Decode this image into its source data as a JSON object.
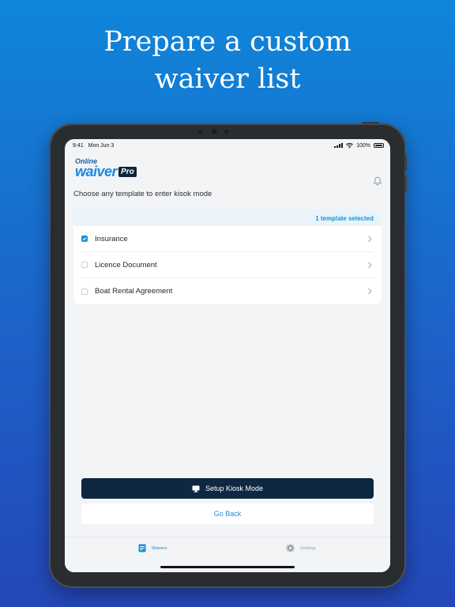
{
  "headline": {
    "line1": "Prepare a custom",
    "line2": "waiver list"
  },
  "statusbar": {
    "time": "9:41",
    "date": "Mon Jun 3",
    "battery": "100%"
  },
  "app": {
    "logo_online": "Online",
    "logo_waiver": "waiver",
    "logo_pro": "Pro"
  },
  "instruction": "Choose any template to enter kisok mode",
  "selection": {
    "count_label": "1 template selected"
  },
  "templates": [
    {
      "label": "Insurance",
      "checked": true
    },
    {
      "label": "Licence Document",
      "checked": false
    },
    {
      "label": "Boat Rental Agreement",
      "checked": false
    }
  ],
  "actions": {
    "setup_kiosk": "Setup Kiosk Mode",
    "go_back": "Go Back"
  },
  "tabs": {
    "waivers": "Waivers",
    "settings": "Settings"
  },
  "colors": {
    "accent": "#1a93d1",
    "primary_button": "#0e2743",
    "background_top": "#0f86d9",
    "background_bottom": "#2447b8"
  },
  "icons": [
    "bell-icon",
    "checkbox-icon",
    "chevron-right-icon",
    "monitor-icon",
    "waivers-tab-icon",
    "gear-icon",
    "wifi-icon",
    "battery-icon"
  ]
}
